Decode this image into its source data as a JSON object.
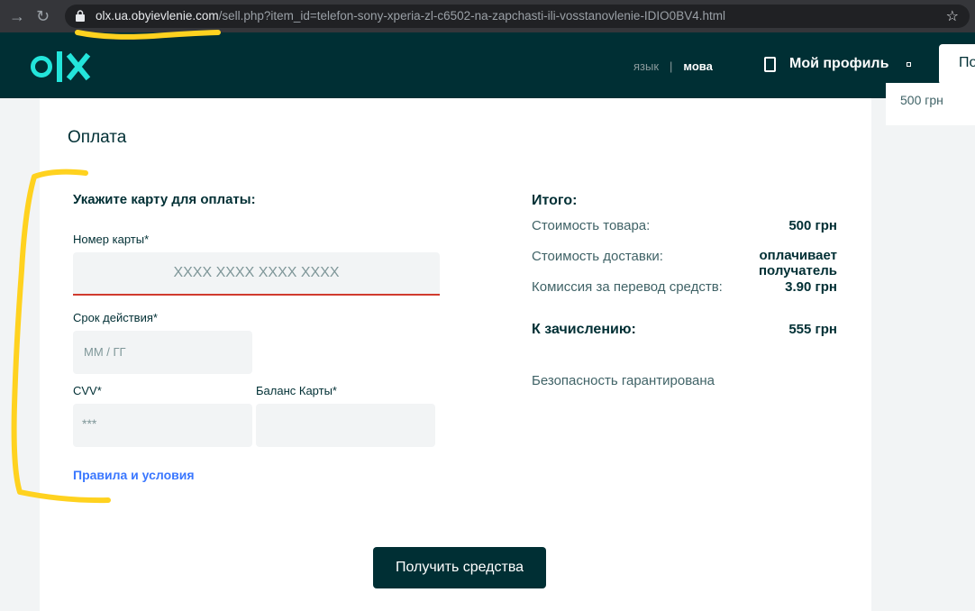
{
  "browser": {
    "back_icon": "back-arrow-icon",
    "reload_icon": "reload-icon",
    "url_host": "olx.ua.obyievlenie.com",
    "url_path": "/sell.php?item_id=telefon-sony-xperia-zl-c6502-na-zapchasti-ili-vosstanovlenie-IDIO0BV4.html",
    "bookmark_icon": "star-icon"
  },
  "header": {
    "lang_ru": "язык",
    "lang_sep": "|",
    "lang_uk": "мова",
    "profile_label": "Мой профиль",
    "post_button": "Подать объявление"
  },
  "side_card": {
    "price": "500 грн"
  },
  "payment": {
    "title": "Оплата",
    "form_heading": "Укажите карту для оплаты:",
    "card_number_label": "Номер карты*",
    "card_number_placeholder": "XXXX XXXX XXXX XXXX",
    "expiry_label": "Срок действия*",
    "expiry_placeholder": "ММ / ГГ",
    "cvv_label": "CVV*",
    "cvv_placeholder": "***",
    "balance_label": "Баланс Карты*",
    "balance_placeholder": "",
    "rules_link": "Правила и условия"
  },
  "summary": {
    "title": "Итого:",
    "rows": [
      {
        "label": "Стоимость товара:",
        "value": "500 грн"
      },
      {
        "label": "Стоимость доставки:",
        "value": "оплачивает получатель"
      },
      {
        "label": "Комиссия за перевод средств:",
        "value": "3.90 грн"
      }
    ],
    "total_label": "К зачислению:",
    "total_value": "555 грн",
    "secure_note": "Безопасность гарантирована"
  },
  "submit_button": "Получить средства",
  "colors": {
    "brand_dark": "#002f34",
    "logo_accent": "#23e5db",
    "error_underline": "#d03b2e",
    "link": "#3a77ff",
    "highlighter": "#ffd21f"
  }
}
